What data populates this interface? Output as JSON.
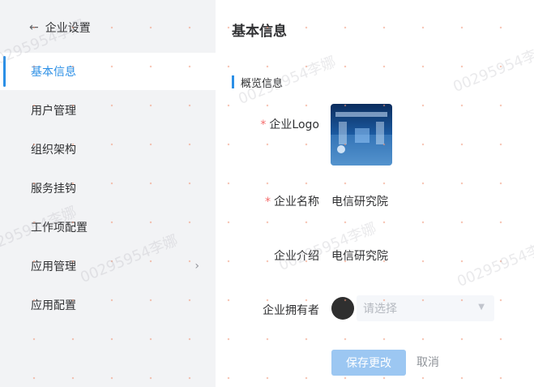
{
  "sidebar": {
    "back_icon": "arrow-left-icon",
    "title": "企业设置",
    "items": [
      {
        "label": "基本信息",
        "active": true
      },
      {
        "label": "用户管理"
      },
      {
        "label": "组织架构"
      },
      {
        "label": "服务挂钩"
      },
      {
        "label": "工作项配置"
      },
      {
        "label": "应用管理",
        "has_chevron": true
      },
      {
        "label": "应用配置"
      }
    ]
  },
  "main": {
    "title": "基本信息",
    "section_title": "概览信息",
    "fields": {
      "logo_label": "企业Logo",
      "name_label": "企业名称",
      "name_value": "电信研究院",
      "intro_label": "企业介绍",
      "intro_value": "电信研究院",
      "owner_label": "企业拥有者",
      "owner_placeholder": "请选择"
    },
    "save_label": "保存更改",
    "cancel_label": "取消"
  },
  "watermark": "00295954李娜",
  "colors": {
    "accent": "#2b8fe6",
    "required": "#f56c6c",
    "primary_button_disabled": "#9cc7f2",
    "sidebar_bg": "#f2f3f5"
  }
}
